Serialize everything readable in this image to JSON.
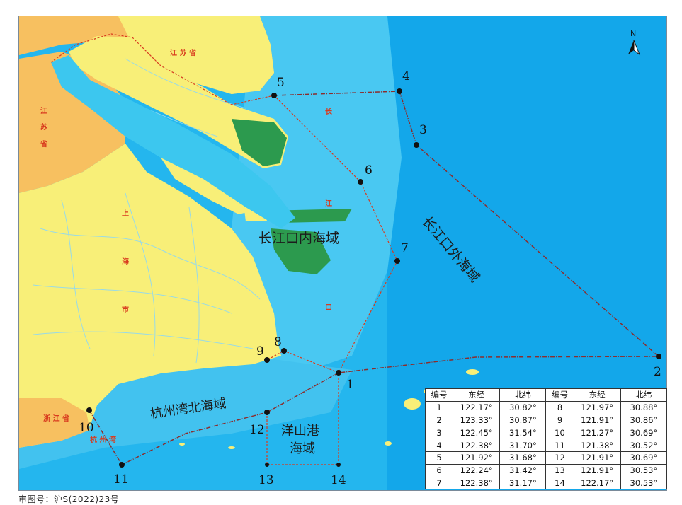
{
  "map": {
    "compass_letter": "N",
    "regions": {
      "inner_sea": "长江口内海域",
      "outer_sea": "长江口外海域",
      "hangzhou_bay_north": "杭州湾北海域",
      "yangshan_line1": "洋山港",
      "yangshan_line2": "海域"
    },
    "place_names": {
      "jiangsu_north": "江  苏  省",
      "jiangsu_west_1": "江",
      "jiangsu_west_2": "苏",
      "jiangsu_west_3": "省",
      "shanghai_1": "上",
      "shanghai_2": "海",
      "shanghai_3": "市",
      "zhejiang": "浙 江 省",
      "changjiang_1": "长",
      "changjiang_2": "江",
      "changjiang_3": "口",
      "hangzhouwan": "杭     州     湾"
    },
    "points": [
      "1",
      "2",
      "3",
      "4",
      "5",
      "6",
      "7",
      "8",
      "9",
      "10",
      "11",
      "12",
      "13",
      "14"
    ],
    "colors": {
      "land": "#f8ef78",
      "land_outer": "#f7c060",
      "river": "#3cc7ef",
      "shallow": "#8fe1f5",
      "sea": "#24b6ee",
      "deep_sea": "#13a7ea",
      "island": "#2c9a4e",
      "boundary": "#c0392b"
    }
  },
  "table": {
    "headers": [
      "编号",
      "东经",
      "北纬",
      "编号",
      "东经",
      "北纬"
    ],
    "rows": [
      [
        "1",
        "122.17°",
        "30.82°",
        "8",
        "121.97°",
        "30.88°"
      ],
      [
        "2",
        "123.33°",
        "30.87°",
        "9",
        "121.91°",
        "30.86°"
      ],
      [
        "3",
        "122.45°",
        "31.54°",
        "10",
        "121.27°",
        "30.69°"
      ],
      [
        "4",
        "122.38°",
        "31.70°",
        "11",
        "121.38°",
        "30.52°"
      ],
      [
        "5",
        "121.92°",
        "31.68°",
        "12",
        "121.91°",
        "30.69°"
      ],
      [
        "6",
        "122.24°",
        "31.42°",
        "13",
        "121.91°",
        "30.53°"
      ],
      [
        "7",
        "122.38°",
        "31.17°",
        "14",
        "122.17°",
        "30.53°"
      ]
    ]
  },
  "approval_note": "审图号：沪S(2022)23号"
}
